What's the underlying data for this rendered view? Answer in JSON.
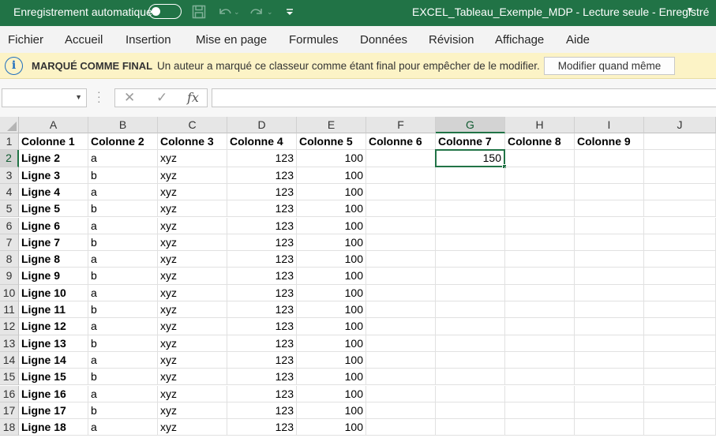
{
  "titlebar": {
    "autosave_label": "Enregistrement automatique",
    "autosave_on": false,
    "doc_title": "EXCEL_Tableau_Exemple_MDP  -  Lecture seule  -  Enregistré",
    "icons": [
      "save-icon",
      "undo-icon",
      "redo-icon",
      "customize-quick-access-icon"
    ]
  },
  "menu": {
    "items": [
      "Fichier",
      "Accueil",
      "Insertion",
      "Mise en page",
      "Formules",
      "Données",
      "Révision",
      "Affichage",
      "Aide"
    ]
  },
  "infobar": {
    "title": "MARQUÉ COMME FINAL",
    "message": "Un auteur a marqué ce classeur comme étant final pour empêcher de le modifier.",
    "button": "Modifier quand même"
  },
  "formulabar": {
    "namebox_value": "",
    "cancel_icon": "✕",
    "enter_icon": "✓",
    "fx_label": "fx",
    "formula_value": ""
  },
  "sheet": {
    "columns": [
      "A",
      "B",
      "C",
      "D",
      "E",
      "F",
      "G",
      "H",
      "I",
      "J"
    ],
    "selected_column": "G",
    "selected_row": "2",
    "row_numbers": [
      "1",
      "2",
      "3",
      "4",
      "5",
      "6",
      "7",
      "8",
      "9",
      "10",
      "11",
      "12",
      "13",
      "14",
      "15",
      "16",
      "17",
      "18"
    ],
    "header_row": [
      "Colonne 1",
      "Colonne 2",
      "Colonne 3",
      "Colonne 4",
      "Colonne 5",
      "Colonne 6",
      "Colonne 7",
      "Colonne 8",
      "Colonne 9",
      ""
    ],
    "rows": [
      [
        "Ligne 2",
        "a",
        "xyz",
        "123",
        "100",
        "",
        "150",
        "",
        "",
        ""
      ],
      [
        "Ligne 3",
        "b",
        "xyz",
        "123",
        "100",
        "",
        "",
        "",
        "",
        ""
      ],
      [
        "Ligne 4",
        "a",
        "xyz",
        "123",
        "100",
        "",
        "",
        "",
        "",
        ""
      ],
      [
        "Ligne 5",
        "b",
        "xyz",
        "123",
        "100",
        "",
        "",
        "",
        "",
        ""
      ],
      [
        "Ligne 6",
        "a",
        "xyz",
        "123",
        "100",
        "",
        "",
        "",
        "",
        ""
      ],
      [
        "Ligne 7",
        "b",
        "xyz",
        "123",
        "100",
        "",
        "",
        "",
        "",
        ""
      ],
      [
        "Ligne 8",
        "a",
        "xyz",
        "123",
        "100",
        "",
        "",
        "",
        "",
        ""
      ],
      [
        "Ligne 9",
        "b",
        "xyz",
        "123",
        "100",
        "",
        "",
        "",
        "",
        ""
      ],
      [
        "Ligne 10",
        "a",
        "xyz",
        "123",
        "100",
        "",
        "",
        "",
        "",
        ""
      ],
      [
        "Ligne 11",
        "b",
        "xyz",
        "123",
        "100",
        "",
        "",
        "",
        "",
        ""
      ],
      [
        "Ligne 12",
        "a",
        "xyz",
        "123",
        "100",
        "",
        "",
        "",
        "",
        ""
      ],
      [
        "Ligne 13",
        "b",
        "xyz",
        "123",
        "100",
        "",
        "",
        "",
        "",
        ""
      ],
      [
        "Ligne 14",
        "a",
        "xyz",
        "123",
        "100",
        "",
        "",
        "",
        "",
        ""
      ],
      [
        "Ligne 15",
        "b",
        "xyz",
        "123",
        "100",
        "",
        "",
        "",
        "",
        ""
      ],
      [
        "Ligne 16",
        "a",
        "xyz",
        "123",
        "100",
        "",
        "",
        "",
        "",
        ""
      ],
      [
        "Ligne 17",
        "b",
        "xyz",
        "123",
        "100",
        "",
        "",
        "",
        "",
        ""
      ],
      [
        "Ligne 18",
        "a",
        "xyz",
        "123",
        "100",
        "",
        "",
        "",
        "",
        ""
      ]
    ]
  },
  "colors": {
    "excel_green": "#217346",
    "infobar_bg": "#fcf3c6",
    "menubar_bg": "#f3f3f3"
  }
}
